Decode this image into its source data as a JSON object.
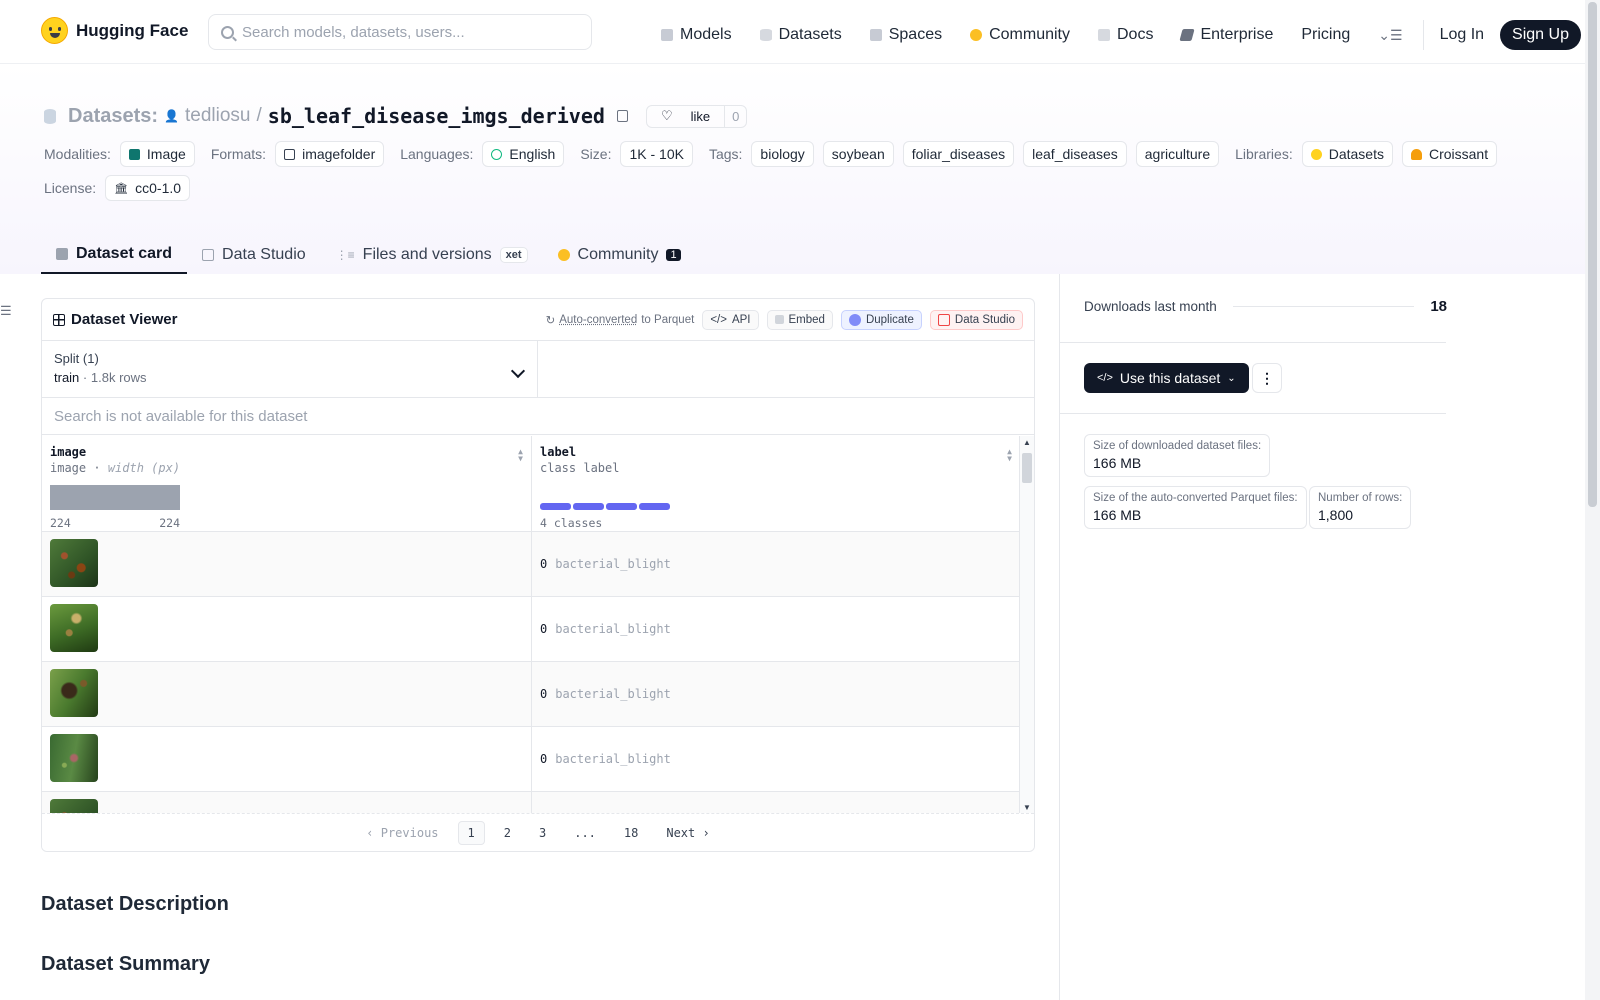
{
  "header": {
    "brand": "Hugging Face",
    "search_placeholder": "Search models, datasets, users...",
    "nav": [
      "Models",
      "Datasets",
      "Spaces",
      "Community",
      "Docs",
      "Enterprise",
      "Pricing"
    ],
    "login": "Log In",
    "signup": "Sign Up"
  },
  "dataset": {
    "prefix": "Datasets:",
    "user": "tedliosu",
    "sep": "/",
    "name": "sb_leaf_disease_imgs_derived",
    "like_label": "like",
    "like_count": "0",
    "meta": {
      "modalities_label": "Modalities:",
      "modality": "Image",
      "formats_label": "Formats:",
      "format": "imagefolder",
      "languages_label": "Languages:",
      "language": "English",
      "size_label": "Size:",
      "size": "1K - 10K",
      "tags_label": "Tags:",
      "tags": [
        "biology",
        "soybean",
        "foliar_diseases",
        "leaf_diseases",
        "agriculture"
      ],
      "libraries_label": "Libraries:",
      "libraries": [
        "Datasets",
        "Croissant"
      ],
      "license_label": "License:",
      "license": "cc0-1.0"
    }
  },
  "tabs": [
    {
      "label": "Dataset card"
    },
    {
      "label": "Data Studio"
    },
    {
      "label": "Files and versions",
      "badge": "xet"
    },
    {
      "label": "Community",
      "badge": "1"
    }
  ],
  "viewer": {
    "title": "Dataset Viewer",
    "auto_converted": "Auto-converted",
    "to_parquet": "to Parquet",
    "actions": [
      "API",
      "Embed",
      "Duplicate",
      "Data Studio"
    ],
    "split_title": "Split (1)",
    "split_name": "train",
    "split_rows": "1.8k rows",
    "search_na": "Search is not available for this dataset",
    "columns": [
      {
        "name": "image",
        "type": "image",
        "type_note": "width (px)",
        "min": "224",
        "max": "224"
      },
      {
        "name": "label",
        "type": "class label",
        "classes": "4 classes"
      }
    ],
    "rows": [
      {
        "id": "0",
        "label": "bacterial_blight"
      },
      {
        "id": "0",
        "label": "bacterial_blight"
      },
      {
        "id": "0",
        "label": "bacterial_blight"
      },
      {
        "id": "0",
        "label": "bacterial_blight"
      }
    ],
    "pager": {
      "prev": "Previous",
      "pages": [
        "1",
        "2",
        "3",
        "...",
        "18"
      ],
      "next": "Next"
    }
  },
  "sections": {
    "description": "Dataset Description",
    "summary": "Dataset Summary"
  },
  "right": {
    "downloads_label": "Downloads last month",
    "downloads": "18",
    "use_button": "Use this dataset",
    "stats": [
      {
        "k": "Size of downloaded dataset files:",
        "v": "166 MB"
      },
      {
        "k": "Size of the auto-converted Parquet files:",
        "v": "166 MB"
      },
      {
        "k": "Number of rows:",
        "v": "1,800"
      }
    ]
  }
}
